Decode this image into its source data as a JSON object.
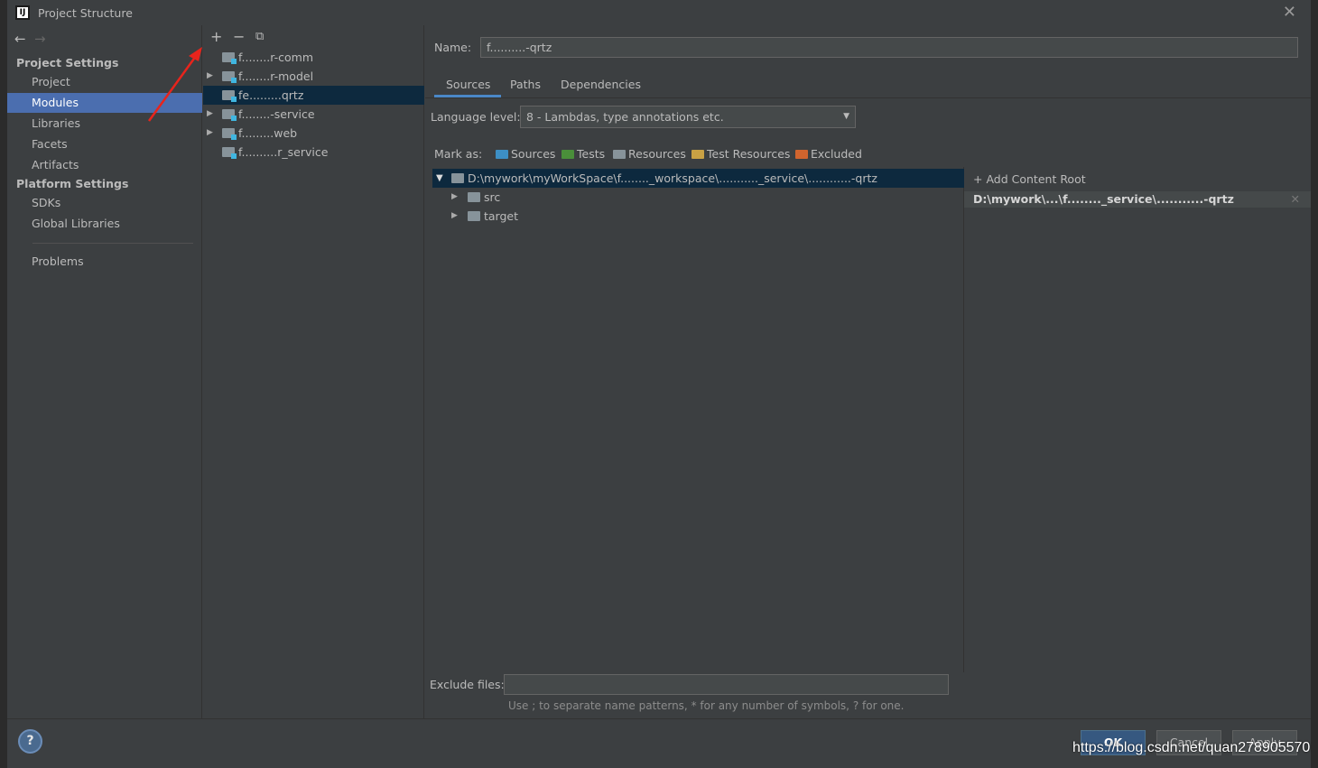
{
  "window": {
    "title": "Project Structure",
    "logo_text": "IJ",
    "close": "✕"
  },
  "sidebar": {
    "back": "←",
    "forward": "→",
    "section1": "Project Settings",
    "items1": [
      "Project",
      "Modules",
      "Libraries",
      "Facets",
      "Artifacts"
    ],
    "section2": "Platform Settings",
    "items2": [
      "SDKs",
      "Global Libraries"
    ],
    "problems": "Problems",
    "selected": "Modules"
  },
  "modules": {
    "toolbar": {
      "add": "+",
      "remove": "−",
      "copy": "⧉"
    },
    "list": [
      {
        "label": "f........r-comm",
        "expandable": false,
        "selected": false
      },
      {
        "label": "f........r-model",
        "expandable": true,
        "selected": false
      },
      {
        "label": "fe.........qrtz",
        "expandable": false,
        "selected": true
      },
      {
        "label": "f........-service",
        "expandable": true,
        "selected": false
      },
      {
        "label": "f.........web",
        "expandable": true,
        "selected": false
      },
      {
        "label": "f..........r_service",
        "expandable": false,
        "selected": false
      }
    ]
  },
  "detail": {
    "name_label": "Name:",
    "name_value": "f..........-qrtz",
    "tabs": [
      "Sources",
      "Paths",
      "Dependencies"
    ],
    "active_tab": "Sources",
    "language_label": "Language level:",
    "language_value": "8 - Lambdas, type annotations etc.",
    "mark_as_label": "Mark as:",
    "mark_buttons": [
      {
        "label": "Sources",
        "color": "#3d8fc4"
      },
      {
        "label": "Tests",
        "color": "#4a8f3a"
      },
      {
        "label": "Resources",
        "color": "#87939a"
      },
      {
        "label": "Test Resources",
        "color": "#c9a144"
      },
      {
        "label": "Excluded",
        "color": "#d0642e"
      }
    ],
    "tree": {
      "root": "D:\\mywork\\myWorkSpace\\f........_workspace\\..........._service\\............-qrtz",
      "children": [
        "src",
        "target"
      ]
    },
    "add_content_root": "Add Content Root",
    "content_root_path": "D:\\mywork\\...\\f........_service\\...........-qrtz",
    "exclude_label": "Exclude files:",
    "exclude_value": "",
    "hint": "Use ; to separate name patterns, * for any number of symbols, ? for one."
  },
  "buttons": {
    "help": "?",
    "ok": "OK",
    "cancel": "Cancel",
    "apply": "Apply"
  },
  "watermark": "https://blog.csdn.net/quan278905570"
}
